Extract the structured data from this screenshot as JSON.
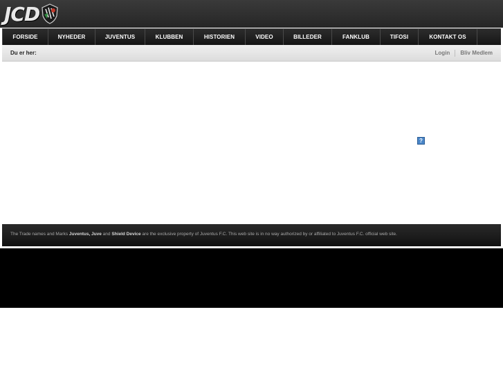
{
  "logo": {
    "text": "JCD"
  },
  "nav": {
    "items": [
      {
        "label": "FORSIDE",
        "name": "forside"
      },
      {
        "label": "NYHEDER",
        "name": "nyheder"
      },
      {
        "label": "JUVENTUS",
        "name": "juventus"
      },
      {
        "label": "KLUBBEN",
        "name": "klubben"
      },
      {
        "label": "HISTORIEN",
        "name": "historien"
      },
      {
        "label": "VIDEO",
        "name": "video"
      },
      {
        "label": "BILLEDER",
        "name": "billeder"
      },
      {
        "label": "FANKLUB",
        "name": "fanklub"
      },
      {
        "label": "TIFOSI",
        "name": "tifosi"
      },
      {
        "label": "KONTAKT OS",
        "name": "kontakt-os"
      }
    ]
  },
  "breadcrumb": {
    "label": "Du er her:"
  },
  "user_links": {
    "login": "Login",
    "register": "Bliv Medlem"
  },
  "broken_image": {
    "glyph": "?"
  },
  "footer": {
    "text_1": "The Trade names and Marks ",
    "bold_1": "Juventus, Juve",
    "text_2": " and ",
    "bold_2": "Shield Device",
    "text_3": " are the exclusive property of Juventus F.C. This web site is in no way authorized by or affiliated to Juventus F.C. official web site."
  },
  "colors": {
    "header": "#2e2e2e",
    "nav": "#1e1e1e",
    "crumbbar": "#e6e6e6",
    "band": "#000000"
  }
}
